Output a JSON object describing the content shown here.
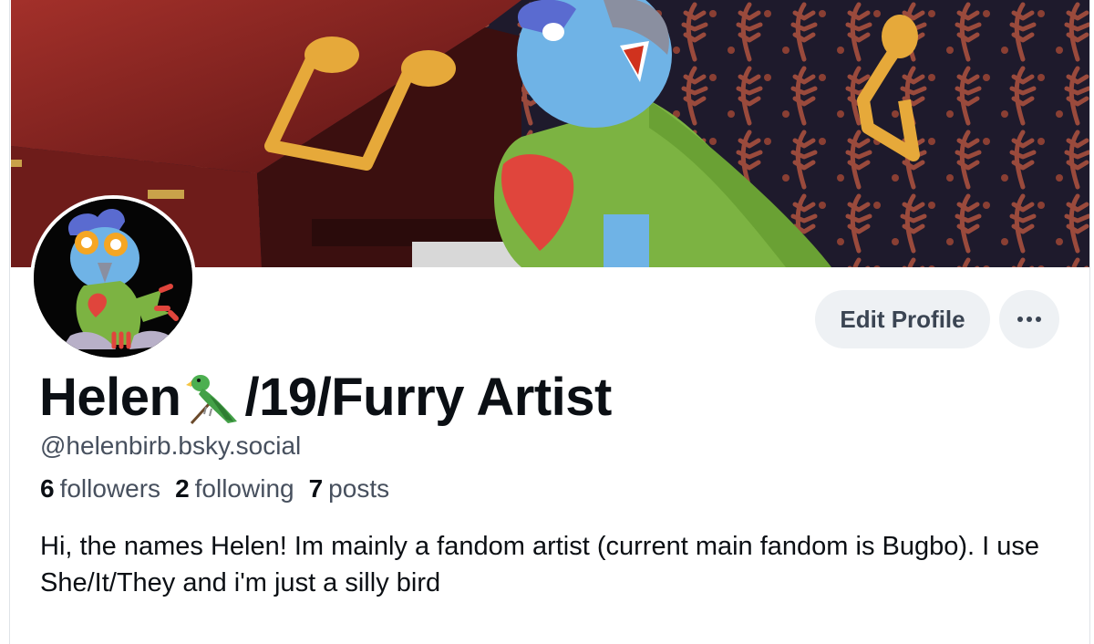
{
  "profile": {
    "display_name_prefix": "Helen",
    "display_name_emoji": "parrot-emoji",
    "display_name_suffix": "/19/Furry Artist",
    "handle": "@helenbirb.bsky.social",
    "stats": {
      "followers_count": "6",
      "followers_label": "followers",
      "following_count": "2",
      "following_label": "following",
      "posts_count": "7",
      "posts_label": "posts"
    },
    "bio": "Hi, the names Helen! Im mainly a fandom artist (current main fandom is Bugbo). I use She/It/They and i'm just a silly bird"
  },
  "actions": {
    "edit_profile_label": "Edit Profile",
    "more_icon": "ellipsis-icon"
  },
  "colors": {
    "button_bg": "#eef1f4",
    "secondary_text": "#47505e",
    "primary_text": "#0b0f14"
  }
}
